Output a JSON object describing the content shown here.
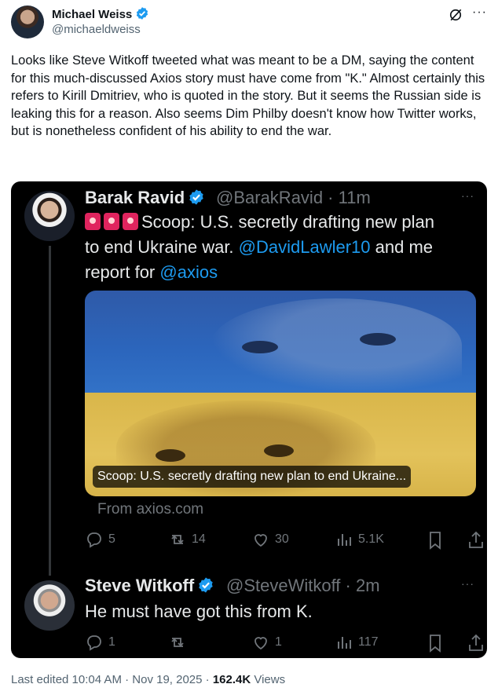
{
  "post": {
    "author_name": "Michael Weiss",
    "author_handle": "@michaeldweiss",
    "more": "···",
    "body": "Looks like Steve Witkoff tweeted what was meant to be a DM, saying the content for this much-discussed Axios story must have come from \"K.\" Almost certainly this refers to Kirill Dmitriev, who is quoted in the story. But it seems the Russian side is leaking this for a reason. Also seems Dim Philby doesn't know how Twitter works, but is nonetheless confident of his ability to end the war.",
    "footer": {
      "edited": "Last edited 10:04 AM · Nov 19, 2025 · ",
      "views_count": "162.4K",
      "views_label": " Views"
    }
  },
  "tweet1": {
    "name": "Barak Ravid",
    "handle": "@BarakRavid · 11m",
    "more": "···",
    "text_a": "Scoop: U.S. secretly drafting new plan",
    "text_b": "to end Ukraine war. ",
    "mention1": "@DavidLawler10",
    "text_c": " and me",
    "text_d": "report for ",
    "mention2": "@axios",
    "card_caption": "Scoop: U.S. secretly drafting new plan to end Ukraine...",
    "card_source": "From axios.com",
    "stats": {
      "replies": "5",
      "reposts": "14",
      "likes": "30",
      "views": "5.1K"
    }
  },
  "tweet2": {
    "name": "Steve Witkoff",
    "handle": "@SteveWitkoff · 2m",
    "more": "···",
    "text": "He must have got this from K.",
    "stats": {
      "replies": "1",
      "reposts": "",
      "likes": "1",
      "views": "117"
    }
  },
  "colors": {
    "accent": "#1d9bf0",
    "verified": "#1d9bf0",
    "dark_bg": "#000000",
    "muted": "#71767b"
  },
  "icons": [
    "verified-badge-icon",
    "grok-icon",
    "more-icon",
    "siren-icon",
    "reply-icon",
    "repost-icon",
    "like-icon",
    "views-icon",
    "bookmark-icon",
    "share-icon"
  ]
}
